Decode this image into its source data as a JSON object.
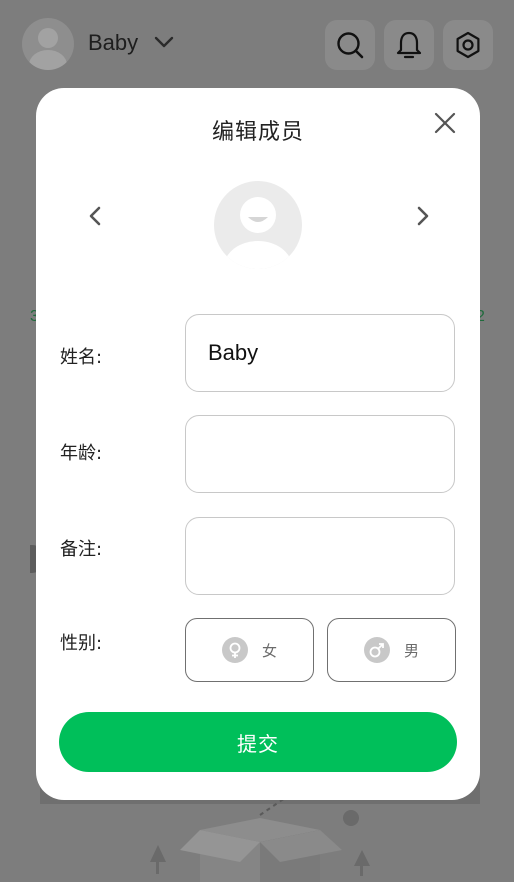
{
  "header": {
    "profile_name": "Baby",
    "icons": [
      "avatar",
      "chevron-down-icon",
      "search-icon",
      "bell-icon",
      "settings-icon"
    ]
  },
  "background": {
    "side_left_text": "3",
    "side_right_text": "2"
  },
  "modal": {
    "title": "编辑成员",
    "name_label": "姓名:",
    "name_value": "Baby",
    "age_label": "年龄:",
    "age_value": "",
    "note_label": "备注:",
    "note_value": "",
    "gender_label": "性别:",
    "gender_options": [
      {
        "label": "女",
        "icon": "female-icon"
      },
      {
        "label": "男",
        "icon": "male-icon"
      }
    ],
    "submit_label": "提交"
  },
  "colors": {
    "accent": "#00bf5a",
    "overlay": "#7d7d7d",
    "field_border": "#c8c8c8"
  }
}
